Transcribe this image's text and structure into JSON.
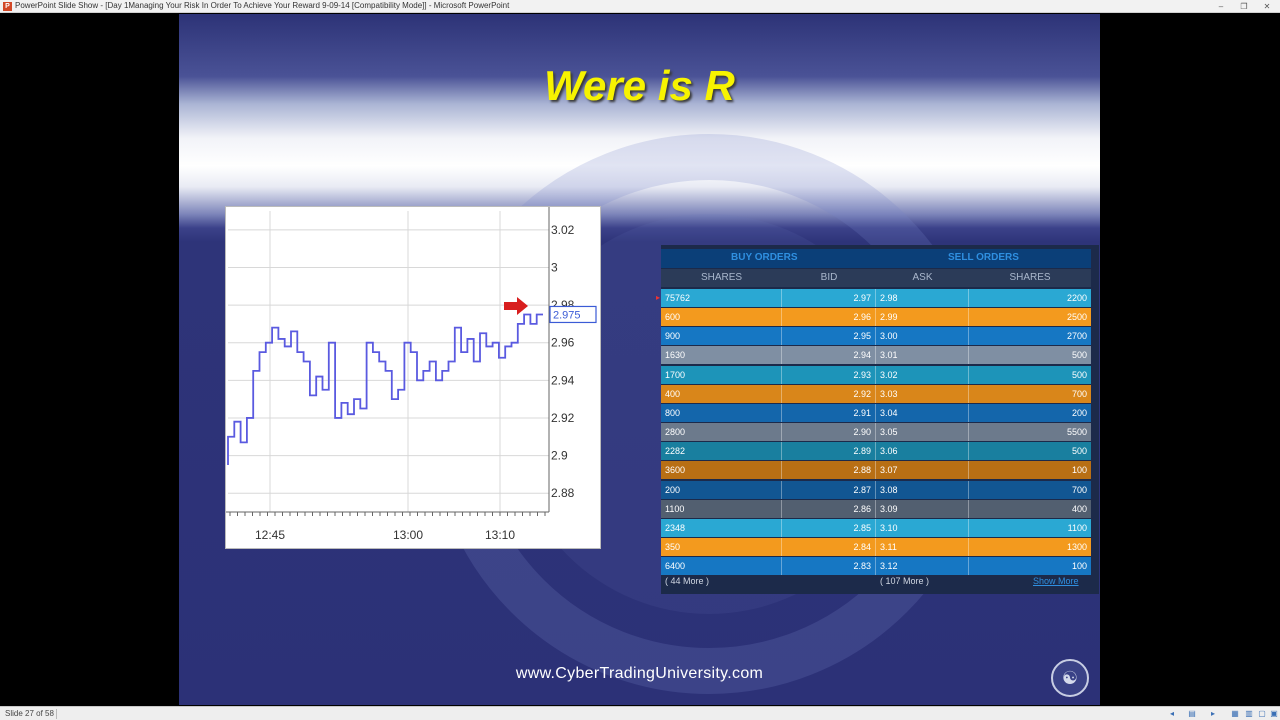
{
  "window": {
    "title": "PowerPoint Slide Show - [Day 1Managing Your Risk In Order To Achieve Your Reward 9-09-14 [Compatibility Mode]] - Microsoft PowerPoint",
    "app_icon": "P",
    "minimize": "‒",
    "restore": "❐",
    "close": "✕"
  },
  "slide": {
    "title": "Were is R",
    "url": "www.CyberTradingUniversity.com",
    "logo": "☯"
  },
  "chart_data": {
    "type": "line",
    "subtype": "step price chart",
    "x_ticks": [
      "12:45",
      "13:00",
      "13:10"
    ],
    "y_ticks": [
      "3.02",
      "3",
      "2.98",
      "2.96",
      "2.94",
      "2.92",
      "2.9",
      "2.88"
    ],
    "ylim": [
      2.87,
      3.03
    ],
    "last_price_label": "2.975",
    "series": [
      {
        "color": "#5a5ae0",
        "values": [
          2.895,
          2.91,
          2.918,
          2.907,
          2.92,
          2.945,
          2.955,
          2.96,
          2.968,
          2.962,
          2.958,
          2.966,
          2.955,
          2.95,
          2.932,
          2.942,
          2.935,
          2.96,
          2.92,
          2.928,
          2.922,
          2.93,
          2.925,
          2.96,
          2.955,
          2.95,
          2.945,
          2.93,
          2.935,
          2.96,
          2.955,
          2.94,
          2.945,
          2.95,
          2.94,
          2.945,
          2.95,
          2.968,
          2.955,
          2.962,
          2.95,
          2.965,
          2.958,
          2.96,
          2.952,
          2.958,
          2.96,
          2.97,
          2.975,
          2.97,
          2.975
        ]
      }
    ]
  },
  "order_book": {
    "buy_header": "BUY ORDERS",
    "sell_header": "SELL ORDERS",
    "columns": [
      "SHARES",
      "BID",
      "ASK",
      "SHARES"
    ],
    "rows": [
      {
        "bid_shares": "75762",
        "bid": "2.97",
        "ask": "2.98",
        "ask_shares": "2200",
        "color": "#2aa8d3"
      },
      {
        "bid_shares": "600",
        "bid": "2.96",
        "ask": "2.99",
        "ask_shares": "2500",
        "color": "#f39a1e"
      },
      {
        "bid_shares": "900",
        "bid": "2.95",
        "ask": "3.00",
        "ask_shares": "2700",
        "color": "#1677c3"
      },
      {
        "bid_shares": "1630",
        "bid": "2.94",
        "ask": "3.01",
        "ask_shares": "500",
        "color": "#7f8fa3"
      },
      {
        "bid_shares": "1700",
        "bid": "2.93",
        "ask": "3.02",
        "ask_shares": "500",
        "color": "#1d94b9"
      },
      {
        "bid_shares": "400",
        "bid": "2.92",
        "ask": "3.03",
        "ask_shares": "700",
        "color": "#d9861a"
      },
      {
        "bid_shares": "800",
        "bid": "2.91",
        "ask": "3.04",
        "ask_shares": "200",
        "color": "#1466ab"
      },
      {
        "bid_shares": "2800",
        "bid": "2.90",
        "ask": "3.05",
        "ask_shares": "5500",
        "color": "#6c7a8c"
      },
      {
        "bid_shares": "2282",
        "bid": "2.89",
        "ask": "3.06",
        "ask_shares": "500",
        "color": "#197f9f"
      },
      {
        "bid_shares": "3600",
        "bid": "2.88",
        "ask": "3.07",
        "ask_shares": "100",
        "color": "#b86f14"
      },
      {
        "bid_shares": "200",
        "bid": "2.87",
        "ask": "3.08",
        "ask_shares": "700",
        "color": "#125692"
      },
      {
        "bid_shares": "1100",
        "bid": "2.86",
        "ask": "3.09",
        "ask_shares": "400",
        "color": "#525f70"
      },
      {
        "bid_shares": "2348",
        "bid": "2.85",
        "ask": "3.10",
        "ask_shares": "1100",
        "color": "#2aa8d3"
      },
      {
        "bid_shares": "350",
        "bid": "2.84",
        "ask": "3.11",
        "ask_shares": "1300",
        "color": "#f39a1e"
      },
      {
        "bid_shares": "6400",
        "bid": "2.83",
        "ask": "3.12",
        "ask_shares": "100",
        "color": "#1677c3"
      }
    ],
    "footer_left": "( 44 More )",
    "footer_mid": "( 107 More )",
    "footer_link": "Show More"
  },
  "statusbar": {
    "slide_indicator": "Slide 27 of 58"
  }
}
